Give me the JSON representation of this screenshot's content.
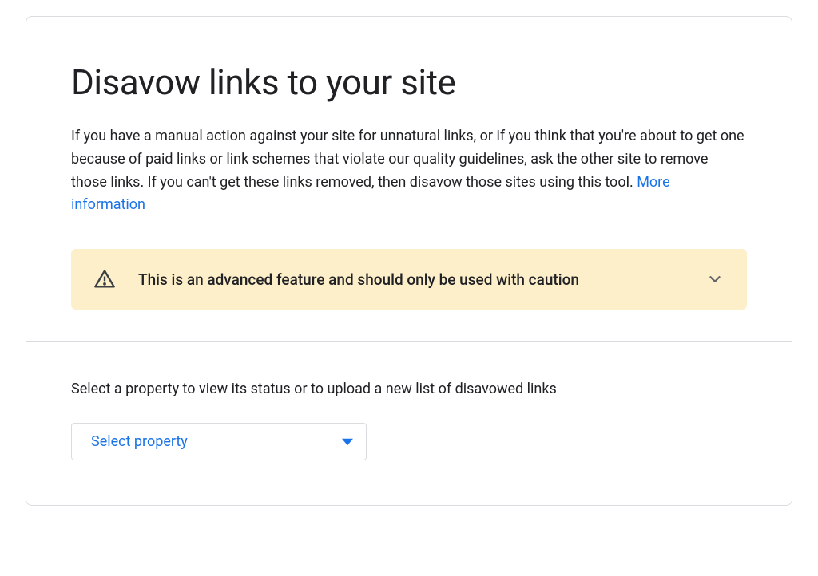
{
  "header": {
    "title": "Disavow links to your site",
    "intro": "If you have a manual action against your site for unnatural links, or if you think that you're about to get one because of paid links or link schemes that violate our quality guidelines, ask the other site to remove those links. If you can't get these links removed, then disavow those sites using this tool. ",
    "more_link": "More information"
  },
  "warning": {
    "text": "This is an advanced feature and should only be used with caution"
  },
  "selector": {
    "label": "Select a property to view its status or to upload a new list of disavowed links",
    "placeholder": "Select property"
  }
}
